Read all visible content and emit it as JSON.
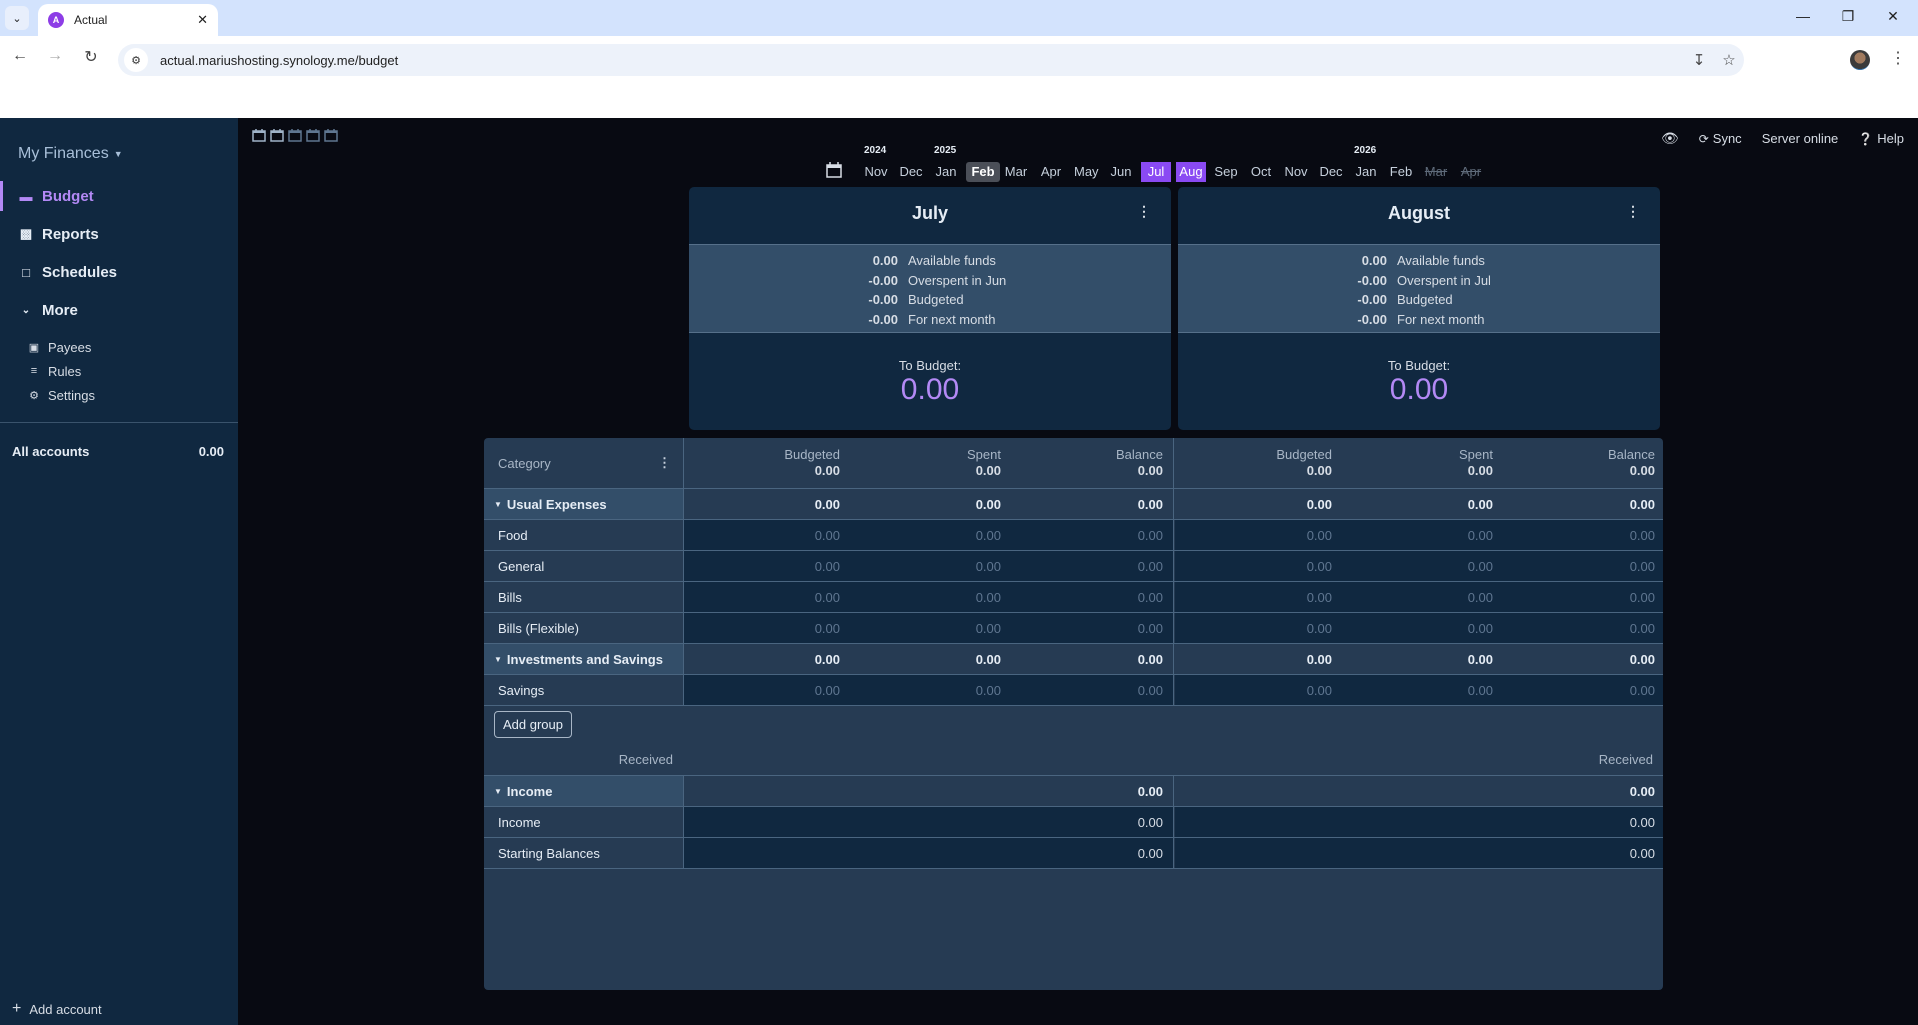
{
  "browser": {
    "tab_title": "Actual",
    "tab_favicon": "A",
    "url": "actual.mariushosting.synology.me/budget"
  },
  "sidebar": {
    "budget_name": "My Finances",
    "nav": [
      {
        "label": "Budget",
        "icon": "wallet-icon",
        "active": true
      },
      {
        "label": "Reports",
        "icon": "chart-icon"
      },
      {
        "label": "Schedules",
        "icon": "calendar-icon"
      },
      {
        "label": "More",
        "icon": "chevron-down-icon"
      }
    ],
    "more_items": [
      {
        "label": "Payees",
        "icon": "store-icon"
      },
      {
        "label": "Rules",
        "icon": "sliders-icon"
      },
      {
        "label": "Settings",
        "icon": "gear-icon"
      }
    ],
    "all_accounts_label": "All accounts",
    "all_accounts_value": "0.00",
    "add_account_label": "Add account"
  },
  "header": {
    "sync_label": "Sync",
    "server_status": "Server online",
    "help_label": "Help"
  },
  "month_picker": {
    "months": [
      {
        "label": "Nov",
        "year": "2024",
        "state": "normal"
      },
      {
        "label": "Dec",
        "state": "normal"
      },
      {
        "label": "Jan",
        "year": "2025",
        "state": "normal"
      },
      {
        "label": "Feb",
        "state": "current"
      },
      {
        "label": "Mar",
        "state": "normal"
      },
      {
        "label": "Apr",
        "state": "normal"
      },
      {
        "label": "May",
        "state": "normal"
      },
      {
        "label": "Jun",
        "state": "normal"
      },
      {
        "label": "Jul",
        "state": "selected"
      },
      {
        "label": "Aug",
        "state": "selected"
      },
      {
        "label": "Sep",
        "state": "normal"
      },
      {
        "label": "Oct",
        "state": "normal"
      },
      {
        "label": "Nov",
        "state": "normal"
      },
      {
        "label": "Dec",
        "state": "normal"
      },
      {
        "label": "Jan",
        "year": "2026",
        "state": "normal"
      },
      {
        "label": "Feb",
        "state": "normal"
      },
      {
        "label": "Mar",
        "state": "disabled"
      },
      {
        "label": "Apr",
        "state": "disabled"
      }
    ]
  },
  "months": [
    {
      "title": "July",
      "summary": [
        {
          "amount": "0.00",
          "label": "Available funds"
        },
        {
          "amount": "-0.00",
          "label": "Overspent in Jun"
        },
        {
          "amount": "-0.00",
          "label": "Budgeted"
        },
        {
          "amount": "-0.00",
          "label": "For next month"
        }
      ],
      "to_budget_label": "To Budget:",
      "to_budget_value": "0.00",
      "totals": {
        "budgeted": "0.00",
        "spent": "0.00",
        "balance": "0.00"
      }
    },
    {
      "title": "August",
      "summary": [
        {
          "amount": "0.00",
          "label": "Available funds"
        },
        {
          "amount": "-0.00",
          "label": "Overspent in Jul"
        },
        {
          "amount": "-0.00",
          "label": "Budgeted"
        },
        {
          "amount": "-0.00",
          "label": "For next month"
        }
      ],
      "to_budget_label": "To Budget:",
      "to_budget_value": "0.00",
      "totals": {
        "budgeted": "0.00",
        "spent": "0.00",
        "balance": "0.00"
      }
    }
  ],
  "table": {
    "category_header": "Category",
    "col_budgeted": "Budgeted",
    "col_spent": "Spent",
    "col_balance": "Balance",
    "col_received": "Received",
    "add_group_label": "Add group",
    "expense_rows": [
      {
        "type": "group",
        "name": "Usual Expenses",
        "m1": [
          "0.00",
          "0.00",
          "0.00"
        ],
        "m2": [
          "0.00",
          "0.00",
          "0.00"
        ]
      },
      {
        "type": "cat",
        "name": "Food",
        "m1": [
          "0.00",
          "0.00",
          "0.00"
        ],
        "m2": [
          "0.00",
          "0.00",
          "0.00"
        ]
      },
      {
        "type": "cat",
        "name": "General",
        "m1": [
          "0.00",
          "0.00",
          "0.00"
        ],
        "m2": [
          "0.00",
          "0.00",
          "0.00"
        ]
      },
      {
        "type": "cat",
        "name": "Bills",
        "m1": [
          "0.00",
          "0.00",
          "0.00"
        ],
        "m2": [
          "0.00",
          "0.00",
          "0.00"
        ]
      },
      {
        "type": "cat",
        "name": "Bills (Flexible)",
        "m1": [
          "0.00",
          "0.00",
          "0.00"
        ],
        "m2": [
          "0.00",
          "0.00",
          "0.00"
        ]
      },
      {
        "type": "group",
        "name": "Investments and Savings",
        "m1": [
          "0.00",
          "0.00",
          "0.00"
        ],
        "m2": [
          "0.00",
          "0.00",
          "0.00"
        ]
      },
      {
        "type": "cat",
        "name": "Savings",
        "m1": [
          "0.00",
          "0.00",
          "0.00"
        ],
        "m2": [
          "0.00",
          "0.00",
          "0.00"
        ]
      }
    ],
    "income_rows": [
      {
        "type": "group",
        "name": "Income",
        "m1": "0.00",
        "m2": "0.00"
      },
      {
        "type": "cat",
        "name": "Income",
        "m1": "0.00",
        "m2": "0.00"
      },
      {
        "type": "cat",
        "name": "Starting Balances",
        "m1": "0.00",
        "m2": "0.00"
      }
    ]
  },
  "colors": {
    "accent": "#b389f5",
    "selected_month": "#8a4af3",
    "sidebar_bg": "#102840",
    "page_bg": "#080a12"
  }
}
